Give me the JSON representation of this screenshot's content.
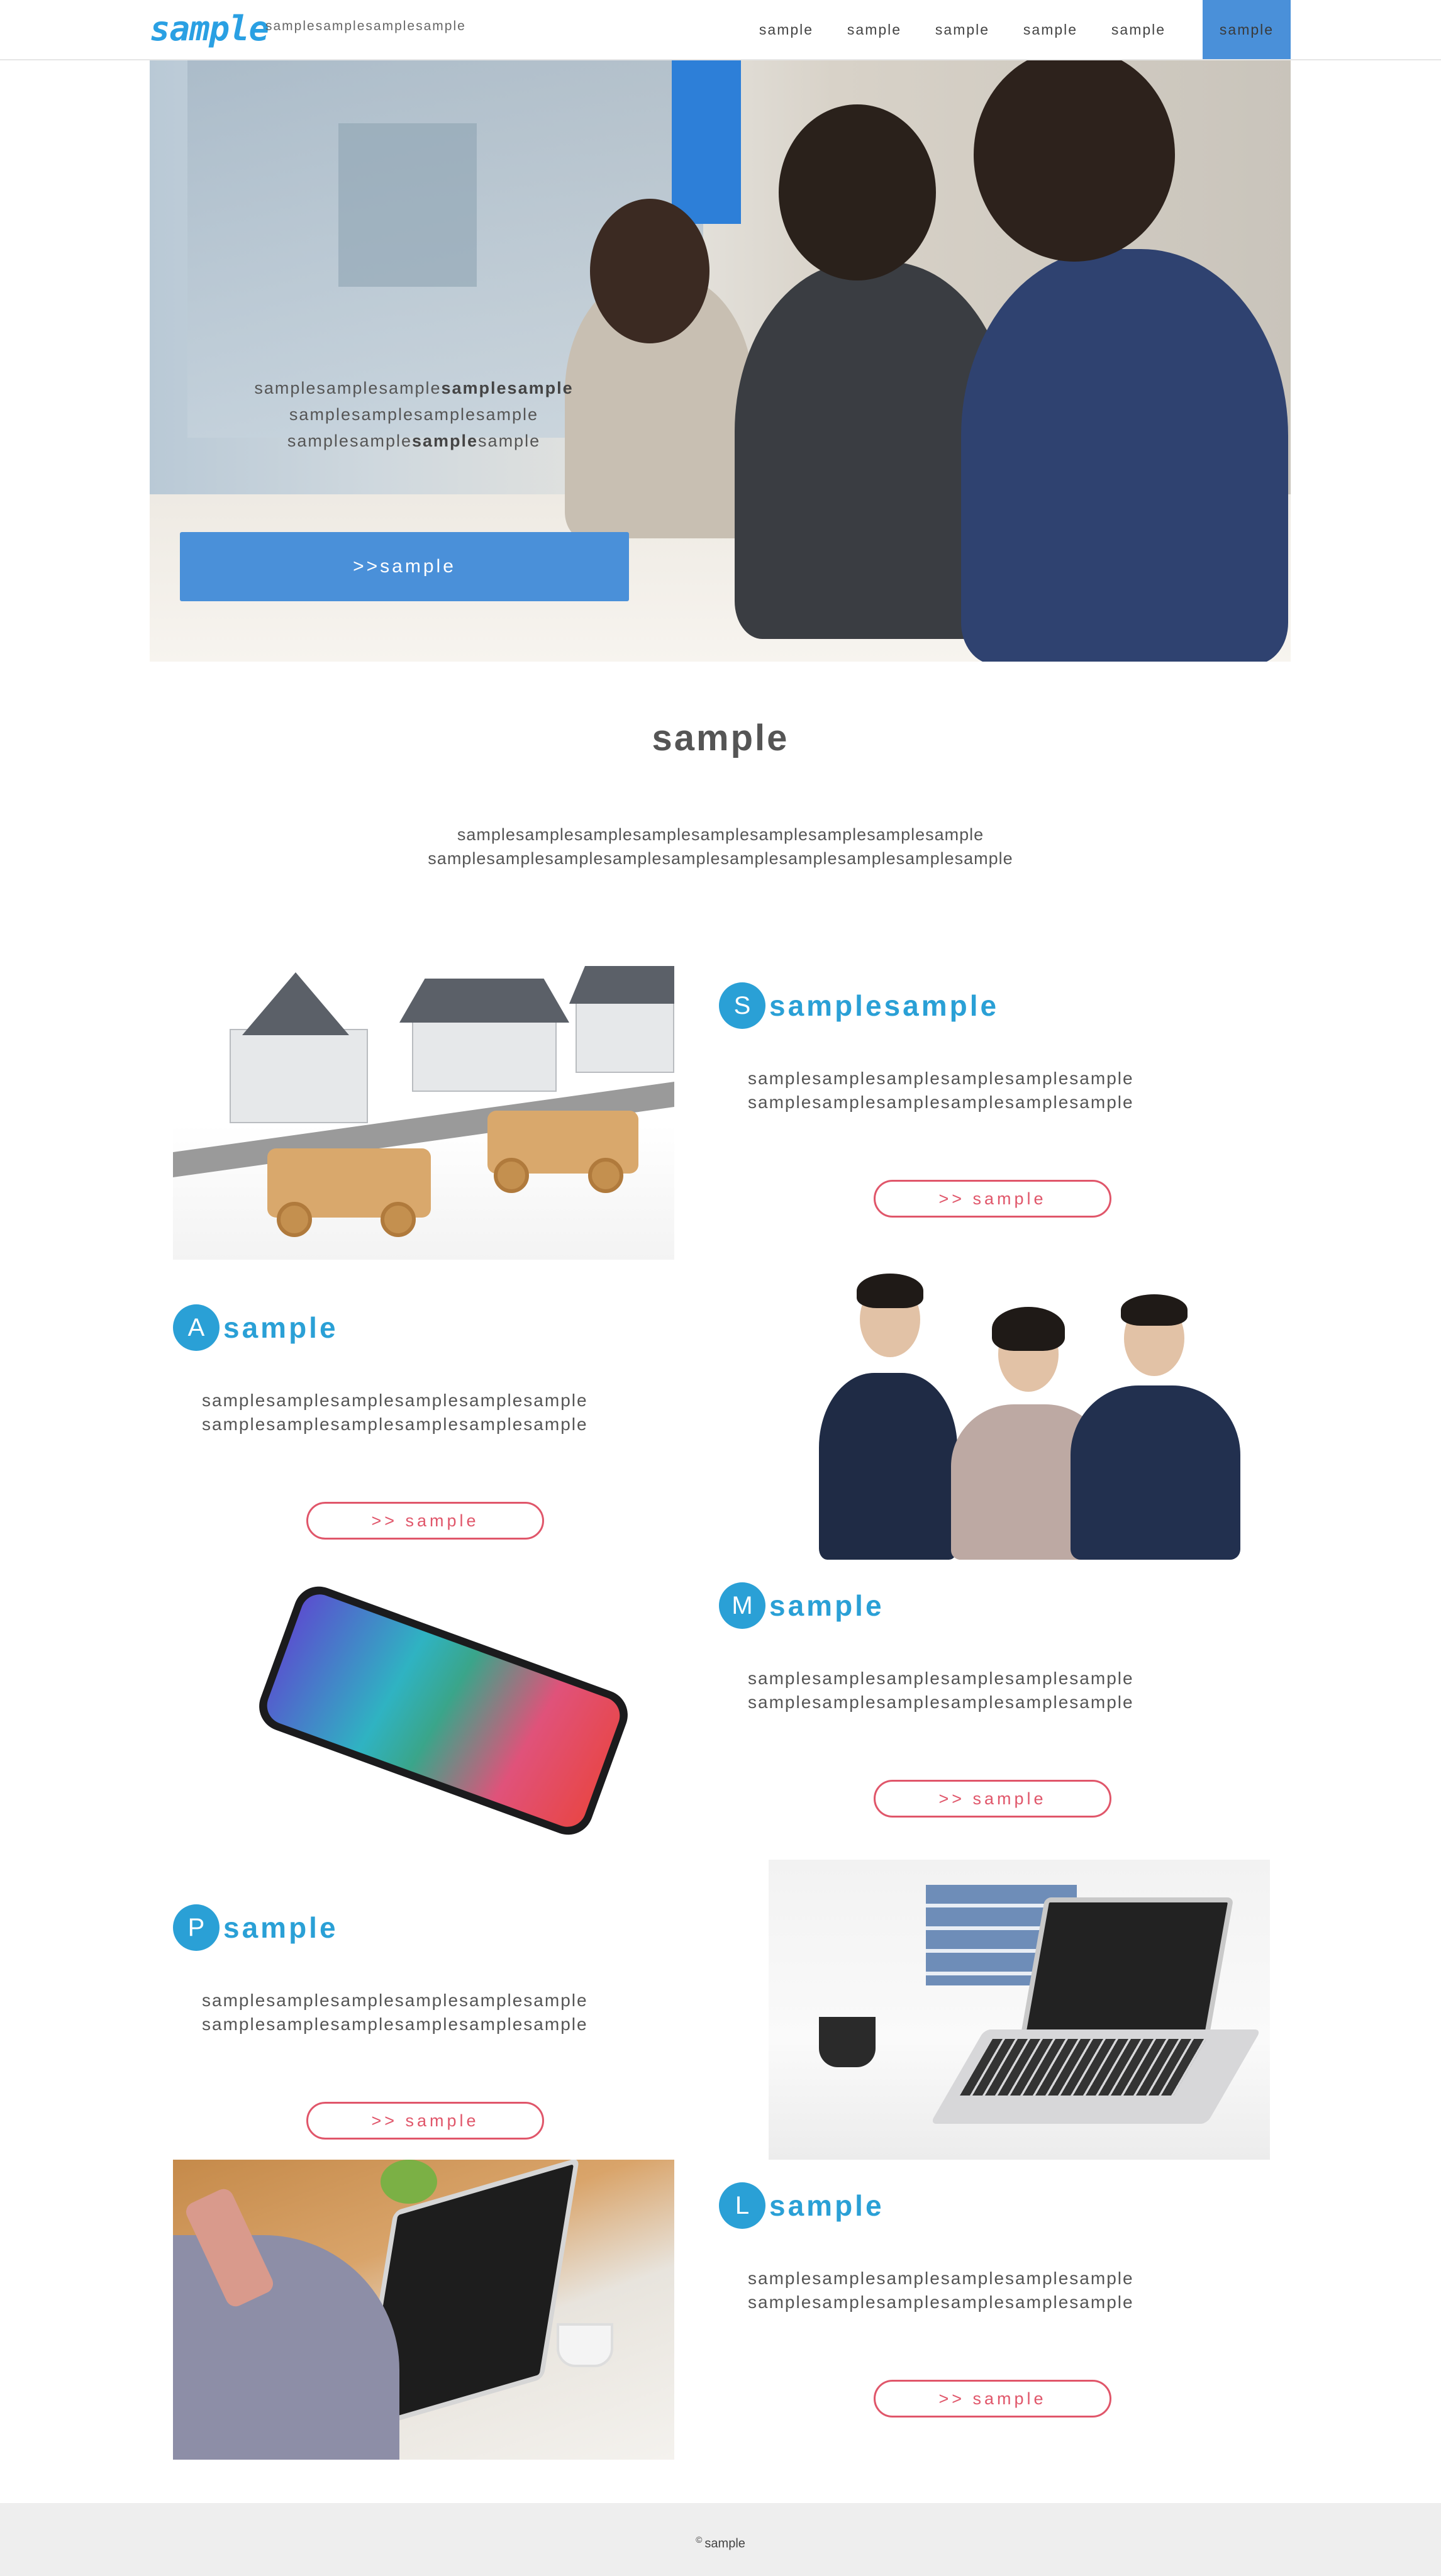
{
  "header": {
    "logo": "sample",
    "tagline": "samplesamplesamplesample",
    "nav": [
      {
        "label": "sample",
        "active": false
      },
      {
        "label": "sample",
        "active": false
      },
      {
        "label": "sample",
        "active": false
      },
      {
        "label": "sample",
        "active": false
      },
      {
        "label": "sample",
        "active": false
      },
      {
        "label": "sample",
        "active": true
      }
    ]
  },
  "hero": {
    "line1_a": "samplesamplesample",
    "line1_b": "samplesample",
    "line2": "samplesamplesamplesample",
    "line3_a": "samplesample",
    "line3_b": "sample",
    "line3_c": "sample",
    "button": ">>sample"
  },
  "intro": {
    "title": "sample",
    "line1": "samplesamplesamplesamplesamplesamplesamplesamplesample",
    "line2": "samplesamplesamplesamplesamplesamplesamplesamplesamplesample"
  },
  "services": [
    {
      "badge": "S",
      "title": "samplesample",
      "line1": "samplesamplesamplesamplesamplesample",
      "line2": "samplesamplesamplesamplesamplesample",
      "button": ">> sample",
      "image": "houses-and-trucks"
    },
    {
      "badge": "A",
      "title": "sample",
      "line1": "samplesamplesamplesamplesamplesample",
      "line2": "samplesamplesamplesamplesamplesample",
      "button": ">> sample",
      "image": "business-team"
    },
    {
      "badge": "M",
      "title": "sample",
      "line1": "samplesamplesamplesamplesamplesample",
      "line2": "samplesamplesamplesamplesamplesample",
      "button": ">> sample",
      "image": "smartphone"
    },
    {
      "badge": "P",
      "title": "sample",
      "line1": "samplesamplesamplesamplesamplesample",
      "line2": "samplesamplesamplesamplesamplesample",
      "button": ">> sample",
      "image": "laptop-desk"
    },
    {
      "badge": "L",
      "title": "sample",
      "line1": "samplesamplesamplesamplesamplesample",
      "line2": "samplesamplesamplesamplesamplesample",
      "button": ">> sample",
      "image": "phone-call-laptop"
    }
  ],
  "footer": {
    "copyright_symbol": "©",
    "text": "sample"
  },
  "colors": {
    "accent_blue": "#4a90d9",
    "badge_blue": "#2aa0d6",
    "button_red": "#e0566a"
  }
}
